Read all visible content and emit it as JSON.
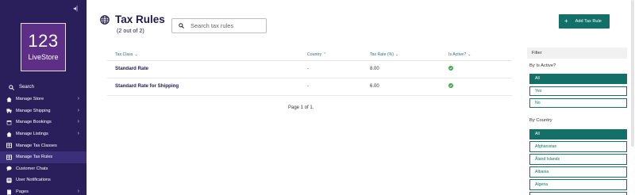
{
  "sidebar": {
    "logo_number": "123",
    "logo_text": "LiveStore",
    "search_label": "Search",
    "items": [
      {
        "label": "Manage Store",
        "icon": "home-icon",
        "has_submenu": true,
        "active": false
      },
      {
        "label": "Manage Shipping",
        "icon": "shipping-icon",
        "has_submenu": true,
        "active": false
      },
      {
        "label": "Manage Bookings",
        "icon": "calendar-icon",
        "has_submenu": true,
        "active": false
      },
      {
        "label": "Manage Listings",
        "icon": "home-icon",
        "has_submenu": true,
        "active": false
      },
      {
        "label": "Manage Tax Classes",
        "icon": "table-icon",
        "has_submenu": false,
        "active": false
      },
      {
        "label": "Manage Tax Rules",
        "icon": "table-icon",
        "has_submenu": false,
        "active": true
      },
      {
        "label": "Customer Chats",
        "icon": "chat-icon",
        "has_submenu": false,
        "active": false
      },
      {
        "label": "User Notifications",
        "icon": "notification-icon",
        "has_submenu": false,
        "active": false
      },
      {
        "label": "Pages",
        "icon": "page-icon",
        "has_submenu": true,
        "active": false
      }
    ]
  },
  "header": {
    "title": "Tax Rules",
    "subtitle": "(2 out of 2)",
    "search_placeholder": "Search tax rules",
    "add_button": "Add Tax Rule"
  },
  "table": {
    "columns": [
      {
        "label": "Tax Class",
        "sort": "down"
      },
      {
        "label": "Country",
        "sort": "up"
      },
      {
        "label": "Tax Rate (%)",
        "sort": "down"
      },
      {
        "label": "Is Active?",
        "sort": "down"
      }
    ],
    "rows": [
      {
        "tax_class": "Standard Rate",
        "country": "-",
        "tax_rate": "8.00",
        "is_active": true
      },
      {
        "tax_class": "Standard Rate for Shipping",
        "country": "-",
        "tax_rate": "6.00",
        "is_active": true
      }
    ],
    "pagination": "Page 1 of 1."
  },
  "filter": {
    "title": "Filter",
    "by_active_label": "By Is Active?",
    "active_options": [
      "All",
      "Yes",
      "No"
    ],
    "active_selected": "All",
    "by_country_label": "By Country",
    "country_options": [
      "All",
      "Afghanistan",
      "Åland Islands",
      "Albania",
      "Algeria"
    ],
    "country_selected": "All"
  },
  "colors": {
    "sidebar_bg": "#2a1f5a",
    "accent": "#137068",
    "title": "#1f1a4d",
    "active_check": "#3eaa4e"
  }
}
